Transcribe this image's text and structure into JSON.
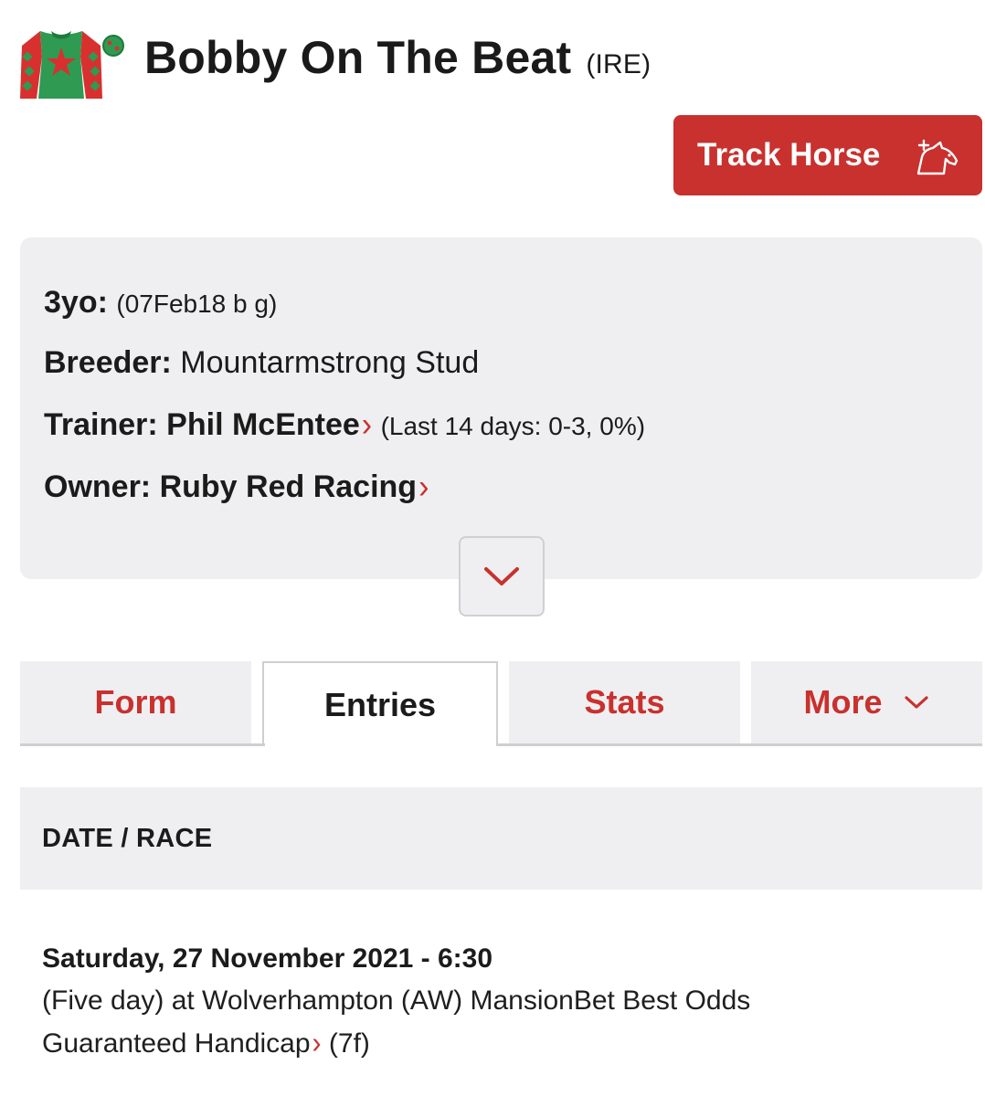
{
  "horse": {
    "name": "Bobby On The Beat",
    "country": "(IRE)"
  },
  "actions": {
    "track_label": "Track Horse"
  },
  "profile": {
    "age_label": "3yo:",
    "age_value": "(07Feb18 b g)",
    "breeder_label": "Breeder:",
    "breeder_value": "Mountarmstrong Stud",
    "trainer_label": "Trainer:",
    "trainer_value": "Phil McEntee",
    "trainer_stats": "(Last 14 days: 0-3, 0%)",
    "owner_label": "Owner:",
    "owner_value": "Ruby Red Racing"
  },
  "tabs": [
    {
      "label": "Form",
      "active": false
    },
    {
      "label": "Entries",
      "active": true
    },
    {
      "label": "Stats",
      "active": false
    },
    {
      "label": "More",
      "active": false
    }
  ],
  "table": {
    "header": "DATE / RACE",
    "entries": [
      {
        "date": "Saturday, 27 November 2021 - 6:30",
        "race_prefix": "(Five day) at Wolverhampton (AW) MansionBet Best Odds",
        "race_suffix": "Guaranteed Handicap",
        "distance": "(7f)"
      }
    ]
  },
  "colors": {
    "accent": "#c8312e",
    "panel": "#efeff1",
    "silks_green": "#2f9a52",
    "silks_red": "#d8302f"
  },
  "icons": {
    "silks": "jockey-silks-icon",
    "track": "horse-plus-icon",
    "expand": "chevron-down-icon",
    "more": "chevron-down-icon",
    "link": "chevron-right-icon"
  }
}
